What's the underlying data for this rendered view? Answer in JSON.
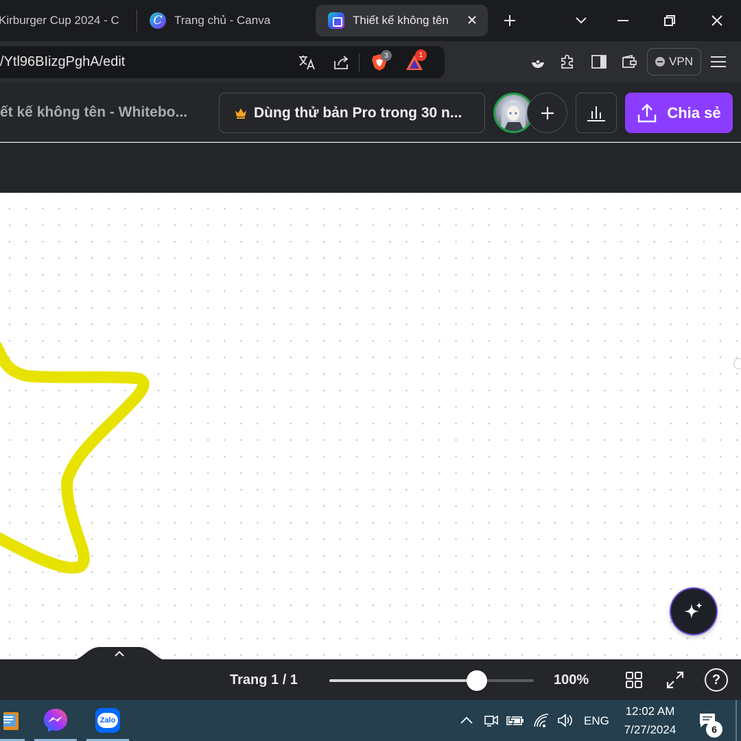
{
  "browser": {
    "tabs": [
      {
        "title": "Kirburger Cup 2024 - C",
        "active": false
      },
      {
        "title": "Trang chủ - Canva",
        "active": false
      },
      {
        "title": "Thiết kế không tên",
        "active": true
      }
    ],
    "new_tab": "+",
    "url": "/Ytl96BIizgPghA/edit",
    "brave_shields_count": "3",
    "rewards_count": "1",
    "vpn_label": "VPN"
  },
  "canva": {
    "doc_title": "ết kế không tên - Whitebo...",
    "pro_trial_label": "Dùng thử bản Pro trong 30 n...",
    "share_label": "Chia sẻ",
    "page_indicator": "Trang 1 / 1",
    "zoom_value": "100%",
    "zoom_fraction": 0.72,
    "help_label": "?"
  },
  "taskbar": {
    "apps": [
      "file-manager-icon",
      "messenger-icon",
      "zalo-icon"
    ],
    "zalo_label": "Zalo",
    "language": "ENG",
    "time": "12:02 AM",
    "date": "7/27/2024",
    "notification_count": "6"
  },
  "colors": {
    "accent_purple": "#8b3dff",
    "star_stroke": "#e8e200",
    "avatar_ring": "#1f9d45"
  }
}
